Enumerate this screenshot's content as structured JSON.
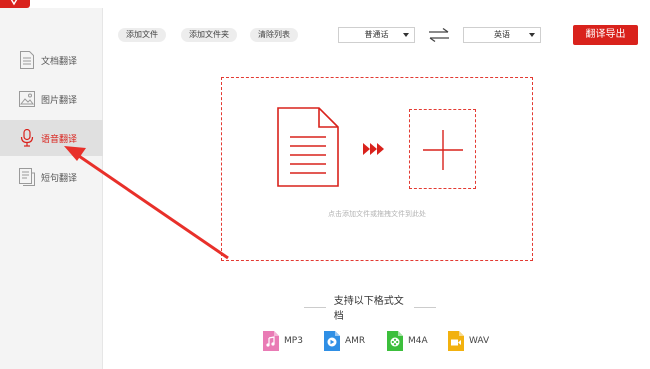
{
  "toolbar": {
    "add_file": "添加文件",
    "add_folder": "添加文件夹",
    "clear_list": "清除列表",
    "export": "翻译导出"
  },
  "languages": {
    "source": "普通话",
    "target": "英语"
  },
  "sidebar": {
    "items": [
      {
        "label": "文档翻译",
        "icon": "document-icon",
        "active": false
      },
      {
        "label": "图片翻译",
        "icon": "image-icon",
        "active": false
      },
      {
        "label": "语音翻译",
        "icon": "microphone-icon",
        "active": true
      },
      {
        "label": "短句翻译",
        "icon": "sentence-icon",
        "active": false
      }
    ]
  },
  "dropzone": {
    "hint": "点击添加文件或拖拽文件到此处"
  },
  "formats": {
    "title": "支持以下格式文档",
    "items": [
      {
        "label": "MP3",
        "icon": "mp3-file-icon",
        "color": "#e97bb5"
      },
      {
        "label": "AMR",
        "icon": "amr-file-icon",
        "color": "#2f8fe5"
      },
      {
        "label": "M4A",
        "icon": "m4a-file-icon",
        "color": "#3cbf3c"
      },
      {
        "label": "WAV",
        "icon": "wav-file-icon",
        "color": "#f2b10f"
      }
    ]
  },
  "colors": {
    "accent": "#d9221c",
    "dashed_border": "#e33a32",
    "sidebar_bg": "#f4f4f4",
    "sidebar_active_bg": "#e0e0e0"
  }
}
